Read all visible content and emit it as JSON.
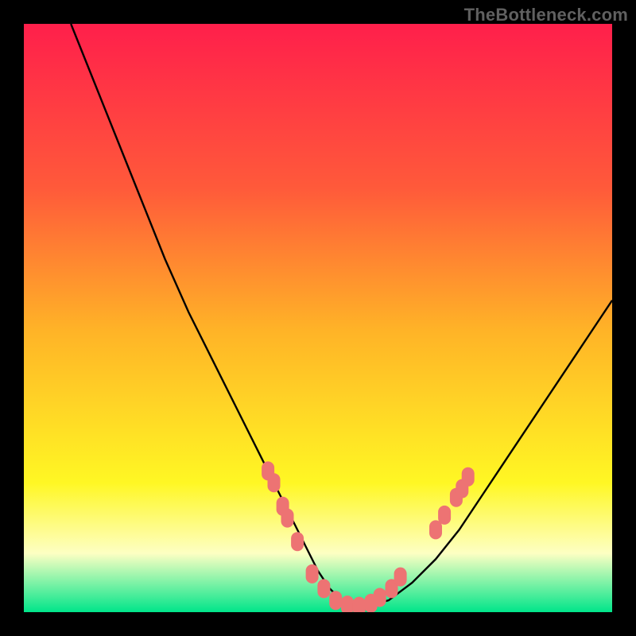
{
  "attribution": "TheBottleneck.com",
  "colors": {
    "gradient_top": "#ff1f4b",
    "gradient_upper": "#ff5a3a",
    "gradient_mid": "#ffb327",
    "gradient_low": "#fff724",
    "gradient_pale": "#fdffc3",
    "gradient_bottom": "#00e58a",
    "curve": "#000000",
    "marker": "#ed7373",
    "frame": "#000000"
  },
  "chart_data": {
    "type": "line",
    "title": "",
    "xlabel": "",
    "ylabel": "",
    "xlim": [
      0,
      100
    ],
    "ylim": [
      0,
      100
    ],
    "grid": false,
    "legend": false,
    "series": [
      {
        "name": "bottleneck-curve",
        "x": [
          8,
          12,
          16,
          20,
          24,
          28,
          32,
          36,
          40,
          44,
          46,
          48,
          50,
          52,
          54,
          56,
          58,
          62,
          66,
          70,
          74,
          78,
          82,
          86,
          90,
          94,
          98,
          100
        ],
        "y": [
          100,
          90,
          80,
          70,
          60,
          51,
          43,
          35,
          27,
          19,
          15,
          11,
          7,
          4,
          2,
          1,
          1,
          2,
          5,
          9,
          14,
          20,
          26,
          32,
          38,
          44,
          50,
          53
        ]
      }
    ],
    "markers": [
      {
        "x": 41.5,
        "y": 24
      },
      {
        "x": 42.5,
        "y": 22
      },
      {
        "x": 44.0,
        "y": 18
      },
      {
        "x": 44.8,
        "y": 16
      },
      {
        "x": 46.5,
        "y": 12
      },
      {
        "x": 49.0,
        "y": 6.5
      },
      {
        "x": 51.0,
        "y": 4
      },
      {
        "x": 53.0,
        "y": 2
      },
      {
        "x": 55.0,
        "y": 1.2
      },
      {
        "x": 57.0,
        "y": 1
      },
      {
        "x": 59.0,
        "y": 1.5
      },
      {
        "x": 60.5,
        "y": 2.5
      },
      {
        "x": 62.5,
        "y": 4
      },
      {
        "x": 64.0,
        "y": 6
      },
      {
        "x": 70.0,
        "y": 14
      },
      {
        "x": 71.5,
        "y": 16.5
      },
      {
        "x": 73.5,
        "y": 19.5
      },
      {
        "x": 74.5,
        "y": 21
      },
      {
        "x": 75.5,
        "y": 23
      }
    ]
  }
}
